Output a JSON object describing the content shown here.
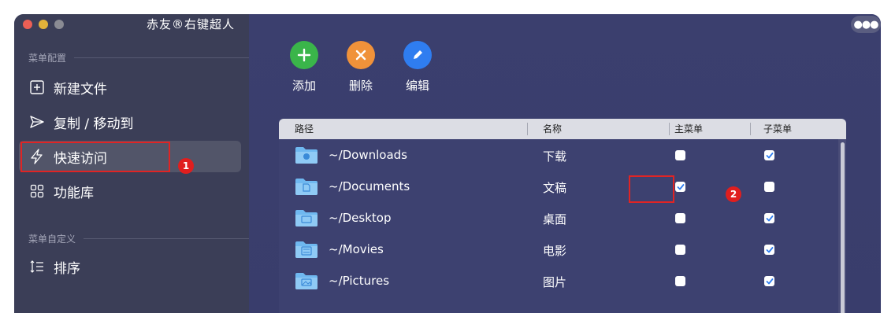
{
  "window": {
    "title": "赤友®右键超人"
  },
  "sidebar": {
    "section1_label": "菜单配置",
    "items": [
      {
        "label": "新建文件",
        "icon": "plus-square-icon"
      },
      {
        "label": "复制 / 移动到",
        "icon": "send-icon"
      },
      {
        "label": "快速访问",
        "icon": "bolt-icon",
        "active": true
      },
      {
        "label": "功能库",
        "icon": "grid-icon"
      }
    ],
    "section2_label": "菜单自定义",
    "items2": [
      {
        "label": "排序",
        "icon": "sort-list-icon"
      }
    ],
    "badge1": "1"
  },
  "toolbar": {
    "add_label": "添加",
    "delete_label": "删除",
    "edit_label": "编辑",
    "more_icon": "ellipsis-icon"
  },
  "table": {
    "headers": {
      "path": "路径",
      "name": "名称",
      "main_menu": "主菜单",
      "sub_menu": "子菜单"
    },
    "rows": [
      {
        "path": "~/Downloads",
        "name": "下载",
        "main": false,
        "sub": true,
        "icon": "downloads-folder-icon"
      },
      {
        "path": "~/Documents",
        "name": "文稿",
        "main": true,
        "sub": false,
        "icon": "documents-folder-icon"
      },
      {
        "path": "~/Desktop",
        "name": "桌面",
        "main": false,
        "sub": true,
        "icon": "desktop-folder-icon"
      },
      {
        "path": "~/Movies",
        "name": "电影",
        "main": false,
        "sub": true,
        "icon": "movies-folder-icon"
      },
      {
        "path": "~/Pictures",
        "name": "图片",
        "main": false,
        "sub": true,
        "icon": "pictures-folder-icon"
      }
    ],
    "badge2": "2"
  },
  "colors": {
    "sidebar_bg": "#3b3e57",
    "main_bg": "#3a3e6e",
    "add": "#3ab54a",
    "delete": "#f0923a",
    "edit": "#2f7df0",
    "highlight": "#e02424",
    "checkbox_check": "#2f7df0"
  }
}
